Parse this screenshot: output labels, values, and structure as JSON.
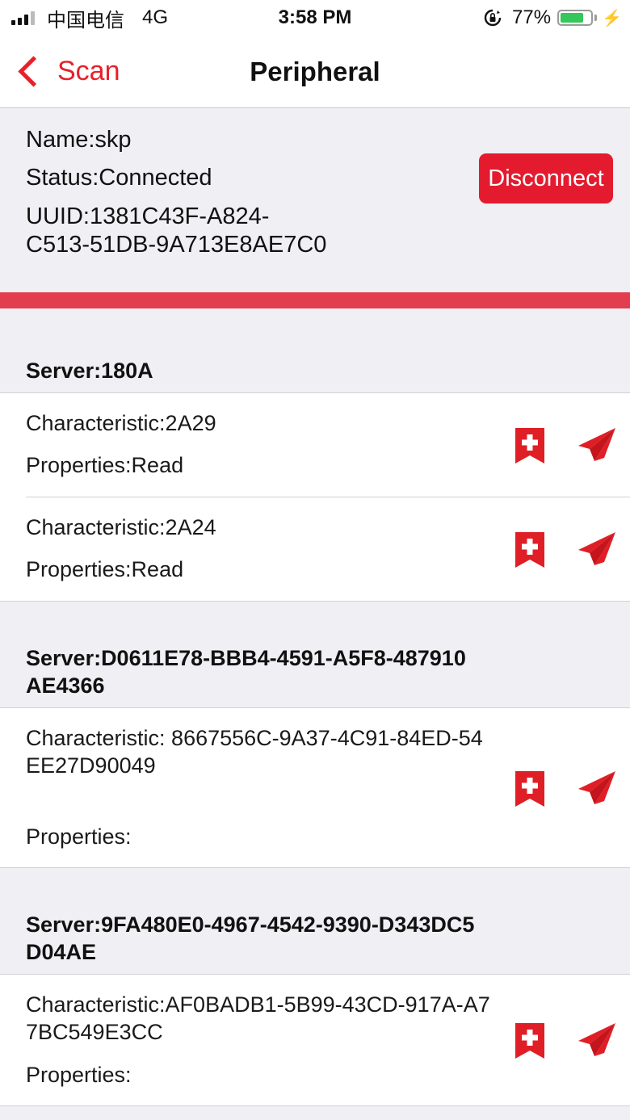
{
  "status_bar": {
    "carrier": "中国电信",
    "network": "4G",
    "time": "3:58 PM",
    "battery_percent": "77%",
    "battery_level": 0.77
  },
  "nav": {
    "back_label": "Scan",
    "title": "Peripheral"
  },
  "device": {
    "name": "Name:skp",
    "status": "Status:Connected",
    "uuid_line1": "UUID:1381C43F-A824-",
    "uuid_line2": "C513-51DB-9A713E8AE7C0",
    "disconnect_label": "Disconnect"
  },
  "services": [
    {
      "header": "Server:180A",
      "characteristics": [
        {
          "characteristic": "Characteristic:2A29",
          "properties": "Properties:Read"
        },
        {
          "characteristic": "Characteristic:2A24",
          "properties": "Properties:Read"
        }
      ]
    },
    {
      "header": "Server:D0611E78-BBB4-4591-A5F8-487910AE4366",
      "characteristics": [
        {
          "characteristic": "Characteristic: 8667556C-9A37-4C91-84ED-54EE27D90049",
          "properties": "Properties:"
        }
      ]
    },
    {
      "header": "Server:9FA480E0-4967-4542-9390-D343DC5D04AE",
      "characteristics": [
        {
          "characteristic": "Characteristic:AF0BADB1-5B99-43CD-917A-A77BC549E3CC",
          "properties": "Properties:"
        }
      ]
    }
  ],
  "icons": {
    "bookmark": "bookmark-plus-icon",
    "send": "paper-plane-icon"
  },
  "colors": {
    "accent": "#e8202a",
    "button": "#e41b2e",
    "banner": "#e33d50",
    "battery": "#34c759",
    "icon": "#e01e26"
  }
}
